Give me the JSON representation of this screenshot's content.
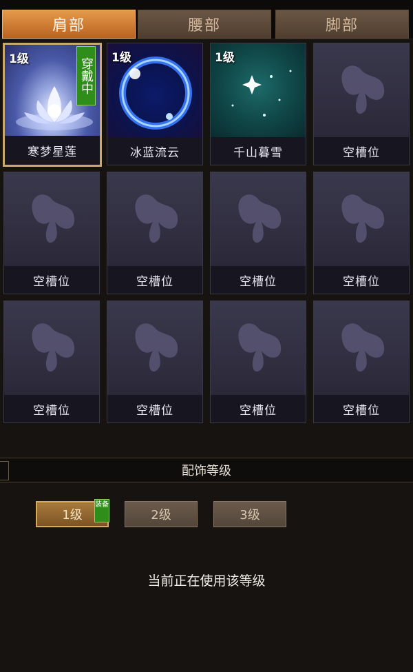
{
  "tabs": [
    {
      "label": "肩部",
      "active": true
    },
    {
      "label": "腰部",
      "active": false
    },
    {
      "label": "脚部",
      "active": false
    }
  ],
  "slots": [
    {
      "name": "寒梦星莲",
      "level": "1级",
      "wearing": "穿戴中",
      "icon": "lotus-icon"
    },
    {
      "name": "冰蓝流云",
      "level": "1级",
      "icon": "blue-orb-icon"
    },
    {
      "name": "千山暮雪",
      "level": "1级",
      "icon": "snow-star-icon"
    },
    {
      "name": "空槽位",
      "icon": "butterfly-placeholder-icon"
    },
    {
      "name": "空槽位",
      "icon": "butterfly-placeholder-icon"
    },
    {
      "name": "空槽位",
      "icon": "butterfly-placeholder-icon"
    },
    {
      "name": "空槽位",
      "icon": "butterfly-placeholder-icon"
    },
    {
      "name": "空槽位",
      "icon": "butterfly-placeholder-icon"
    },
    {
      "name": "空槽位",
      "icon": "butterfly-placeholder-icon"
    },
    {
      "name": "空槽位",
      "icon": "butterfly-placeholder-icon"
    },
    {
      "name": "空槽位",
      "icon": "butterfly-placeholder-icon"
    },
    {
      "name": "空槽位",
      "icon": "butterfly-placeholder-icon"
    }
  ],
  "section_title": "配饰等级",
  "levels": [
    {
      "label": "1级",
      "selected": true,
      "badge": "装备"
    },
    {
      "label": "2级",
      "selected": false
    },
    {
      "label": "3级",
      "selected": false
    }
  ],
  "status_text": "当前正在使用该等级",
  "colors": {
    "accent": "#e59a4a",
    "equipped_green": "#2f8d1a",
    "panel_bg": "#161311"
  }
}
